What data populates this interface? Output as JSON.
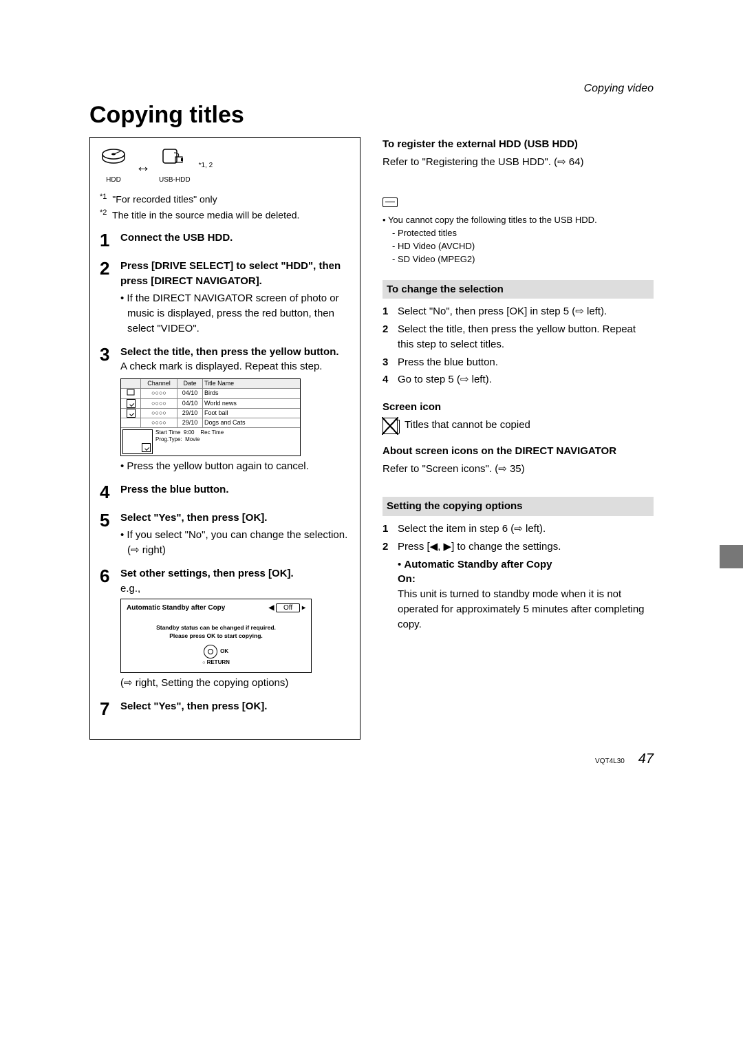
{
  "breadcrumb": "Copying video",
  "title": "Copying titles",
  "icons": {
    "hdd_label": "HDD",
    "usb_label": "USB-HDD",
    "sup_marks": "*1, 2"
  },
  "footnotes": {
    "f1_marker": "*1",
    "f1_text": "\"For recorded titles\" only",
    "f2_marker": "*2",
    "f2_text": "The title in the source media will be deleted."
  },
  "steps": {
    "s1": {
      "head": "Connect the USB HDD."
    },
    "s2": {
      "head": "Press [DRIVE SELECT] to select \"HDD\", then press [DIRECT NAVIGATOR].",
      "sub": "If the DIRECT NAVIGATOR screen of photo or music is displayed, press the red button, then select \"VIDEO\"."
    },
    "s3": {
      "head": "Select the title, then press the yellow button.",
      "body": "A check mark is displayed. Repeat this step.",
      "sub": "Press the yellow button again to cancel."
    },
    "s4": {
      "head": "Press the blue button."
    },
    "s5": {
      "head": "Select \"Yes\", then press [OK].",
      "sub": "If you select \"No\", you can change the selection. (⇨ right)"
    },
    "s6": {
      "head": "Set other settings, then press [OK].",
      "eg": "e.g.,",
      "link": "right, Setting the copying options"
    },
    "s7": {
      "head": "Select \"Yes\", then press [OK]."
    }
  },
  "thumb_table": {
    "headers": {
      "channel": "Channel",
      "date": "Date",
      "title": "Title Name"
    },
    "rows": [
      {
        "ch": "○○○○",
        "date": "04/10",
        "title": "Birds"
      },
      {
        "ch": "○○○○",
        "date": "04/10",
        "title": "World news"
      },
      {
        "ch": "○○○○",
        "date": "29/10",
        "title": "Foot ball"
      },
      {
        "ch": "○○○○",
        "date": "29/10",
        "title": "Dogs and Cats"
      }
    ],
    "detail": {
      "start": "Start Time",
      "start_v": "9:00",
      "rec": "Rec Time",
      "prog": "Prog.Type:",
      "prog_v": "Movie"
    }
  },
  "standby_box": {
    "label": "Automatic Standby after Copy",
    "value": "Off",
    "msg1": "Standby status can be changed if required.",
    "msg2": "Please press OK to start copying.",
    "ok": "OK",
    "return": "RETURN"
  },
  "right": {
    "register_head": "To register the external HDD (USB HDD)",
    "register_body": "Refer to \"Registering the USB HDD\". (⇨ 64)",
    "note_intro": "You cannot copy the following titles to the USB HDD.",
    "note_items": [
      "Protected titles",
      "HD Video (AVCHD)",
      "SD Video (MPEG2)"
    ],
    "change_head": "To change the selection",
    "change_items": [
      "Select \"No\", then press [OK] in step 5 (⇨ left).",
      "Select the title, then press the yellow button. Repeat this step to select titles.",
      "Press the blue button.",
      "Go to step 5 (⇨ left)."
    ],
    "screen_icon_head": "Screen icon",
    "screen_icon_text": "Titles that cannot be copied",
    "about_head": "About screen icons on the DIRECT NAVIGATOR",
    "about_body": "Refer to \"Screen icons\". (⇨ 35)",
    "setting_head": "Setting the copying options",
    "setting_items": [
      "Select the item in step 6 (⇨ left).",
      "Press [◀, ▶] to change the settings."
    ],
    "auto_head": "Automatic Standby after Copy",
    "auto_on": "On:",
    "auto_body": "This unit is turned to standby mode when it is not operated for approximately 5 minutes after completing copy."
  },
  "footer": {
    "code": "VQT4L30",
    "page": "47"
  }
}
